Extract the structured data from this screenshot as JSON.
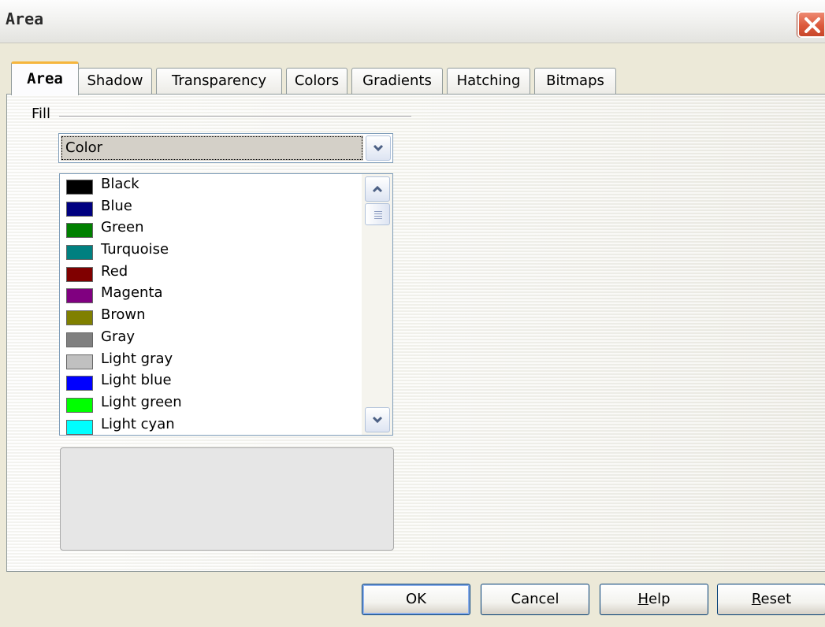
{
  "window": {
    "title": "Area",
    "close_icon": "close-icon"
  },
  "tabs": [
    {
      "label": "Area",
      "active": true
    },
    {
      "label": "Shadow"
    },
    {
      "label": "Transparency"
    },
    {
      "label": "Colors"
    },
    {
      "label": "Gradients"
    },
    {
      "label": "Hatching"
    },
    {
      "label": "Bitmaps"
    }
  ],
  "fill": {
    "group_label": "Fill",
    "type_select": {
      "value": "Color"
    },
    "colors": [
      {
        "name": "Black",
        "color": "#000000"
      },
      {
        "name": "Blue",
        "color": "#000080"
      },
      {
        "name": "Green",
        "color": "#008000"
      },
      {
        "name": "Turquoise",
        "color": "#008080"
      },
      {
        "name": "Red",
        "color": "#800000"
      },
      {
        "name": "Magenta",
        "color": "#800080"
      },
      {
        "name": "Brown",
        "color": "#808000"
      },
      {
        "name": "Gray",
        "color": "#808080"
      },
      {
        "name": "Light gray",
        "color": "#c0c0c0"
      },
      {
        "name": "Light blue",
        "color": "#0000ff"
      },
      {
        "name": "Light green",
        "color": "#00ff00"
      },
      {
        "name": "Light cyan",
        "color": "#00ffff"
      }
    ]
  },
  "buttons": {
    "ok": "OK",
    "cancel": "Cancel",
    "help": {
      "mnemonic": "H",
      "rest": "elp"
    },
    "reset": {
      "mnemonic": "R",
      "rest": "eset"
    }
  }
}
